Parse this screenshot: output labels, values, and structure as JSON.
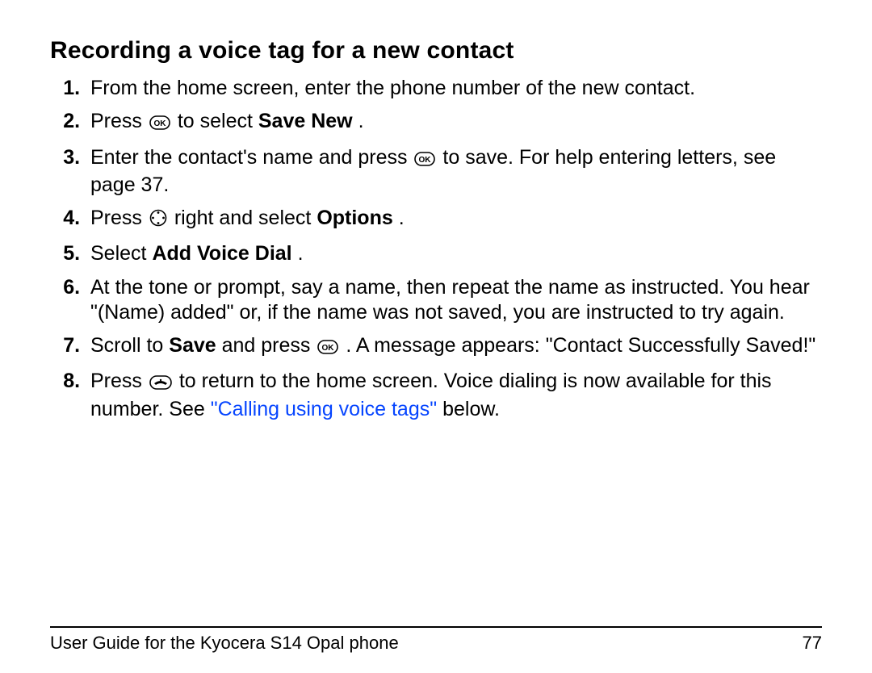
{
  "heading": "Recording a voice tag for a new contact",
  "steps": {
    "s1": "From the home screen, enter the phone number of the new contact.",
    "s2a": "Press ",
    "s2b": " to select ",
    "s2_bold": "Save New",
    "s2c": ".",
    "s3a": "Enter the contact's name and press ",
    "s3b": " to save. For help entering letters, see page 37.",
    "s4a": "Press ",
    "s4b": " right and select ",
    "s4_bold": "Options",
    "s4c": ".",
    "s5a": "Select ",
    "s5_bold": "Add Voice Dial",
    "s5b": ".",
    "s6": "At the tone or prompt, say a name, then repeat the name as instructed. You hear \"(Name) added\" or, if the name was not saved, you are instructed to try again.",
    "s7a": "Scroll to ",
    "s7_bold": "Save",
    "s7b": " and press ",
    "s7c": ". A message appears: \"Contact Successfully Saved!\"",
    "s8a": "Press ",
    "s8b": " to return to the home screen. Voice dialing is now available for this number. See ",
    "s8_link": "\"Calling using voice tags\"",
    "s8c": " below."
  },
  "footer": {
    "title": "User Guide for the Kyocera S14 Opal phone",
    "page": "77"
  }
}
